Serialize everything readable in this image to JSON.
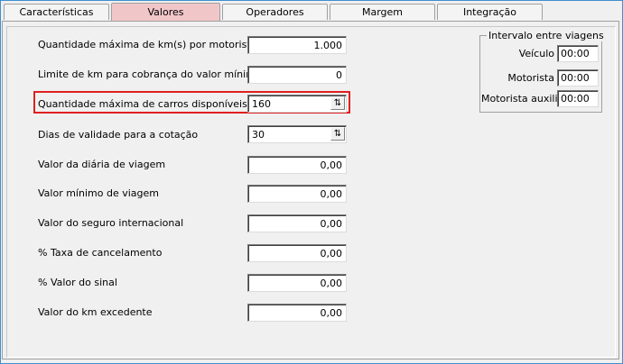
{
  "tabs": [
    {
      "label": "Características",
      "active": false
    },
    {
      "label": "Valores",
      "active": true
    },
    {
      "label": "Operadores",
      "active": false
    },
    {
      "label": "Margem",
      "active": false
    },
    {
      "label": "Integração",
      "active": false
    }
  ],
  "fields": [
    {
      "label": "Quantidade máxima de km(s) por motorista",
      "value": "1.000"
    },
    {
      "label": "Limite de km para cobrança do valor mínimo",
      "value": "0"
    },
    {
      "label": "Quantidade máxima de carros disponíveis",
      "value": "160"
    },
    {
      "label": "Dias de validade para a cotação",
      "value": "30"
    },
    {
      "label": "Valor da diária de viagem",
      "value": "0,00"
    },
    {
      "label": "Valor mínimo de viagem",
      "value": "0,00"
    },
    {
      "label": "Valor do seguro internacional",
      "value": "0,00"
    },
    {
      "label": "% Taxa de cancelamento",
      "value": "0,00"
    },
    {
      "label": "% Valor do sinal",
      "value": "0,00"
    },
    {
      "label": "Valor do km excedente",
      "value": "0,00"
    }
  ],
  "intervalo": {
    "title": "Intervalo entre viagens",
    "items": [
      {
        "label": "Veículo",
        "value": "00:00"
      },
      {
        "label": "Motorista",
        "value": "00:00"
      },
      {
        "label": "Motorista auxiliar",
        "value": "00:00"
      }
    ]
  },
  "highlight_color": "#e02020",
  "active_tab_color": "#f1c6c8"
}
